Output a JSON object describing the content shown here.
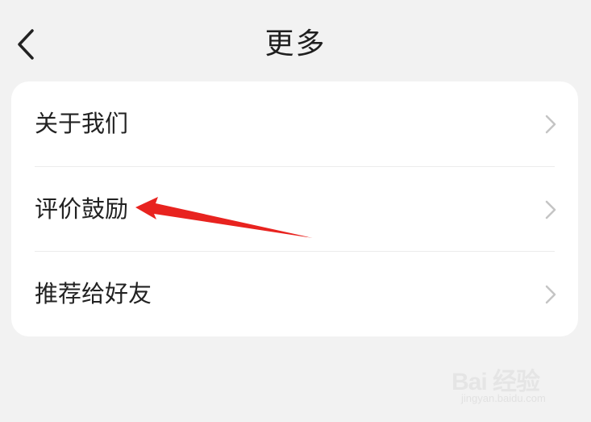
{
  "header": {
    "title": "更多",
    "back_icon": "chevron-left-icon"
  },
  "menu": {
    "items": [
      {
        "label": "关于我们",
        "icon": "chevron-right-icon"
      },
      {
        "label": "评价鼓励",
        "icon": "chevron-right-icon"
      },
      {
        "label": "推荐给好友",
        "icon": "chevron-right-icon"
      }
    ]
  },
  "annotation": {
    "arrow_color": "#e8231f",
    "points_to": "评价鼓励"
  },
  "watermark": {
    "logo": "Bai 经验",
    "url": "jingyan.baidu.com"
  },
  "colors": {
    "page_background": "#f2f2f2",
    "card_background": "#ffffff",
    "text": "#222222",
    "chevron": "#c4c4c4"
  }
}
